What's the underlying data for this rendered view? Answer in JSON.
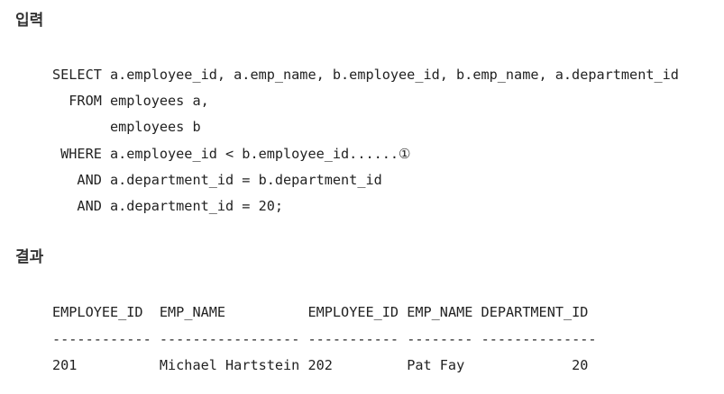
{
  "headings": {
    "input": "입력",
    "result": "결과"
  },
  "query_lines": [
    "SELECT a.employee_id, a.emp_name, b.employee_id, b.emp_name, a.department_id",
    "  FROM employees a,",
    "       employees b",
    " WHERE a.employee_id < b.employee_id......①",
    "   AND a.department_id = b.department_id",
    "   AND a.department_id = 20;"
  ],
  "result_table": {
    "columns": [
      "EMPLOYEE_ID",
      "EMP_NAME",
      "EMPLOYEE_ID",
      "EMP_NAME",
      "DEPARTMENT_ID"
    ],
    "separators": [
      "------------",
      "-----------------",
      "-----------",
      "--------",
      "--------------"
    ],
    "rows": [
      [
        "201",
        "Michael Hartstein",
        "202",
        "Pat Fay",
        "20"
      ]
    ]
  }
}
